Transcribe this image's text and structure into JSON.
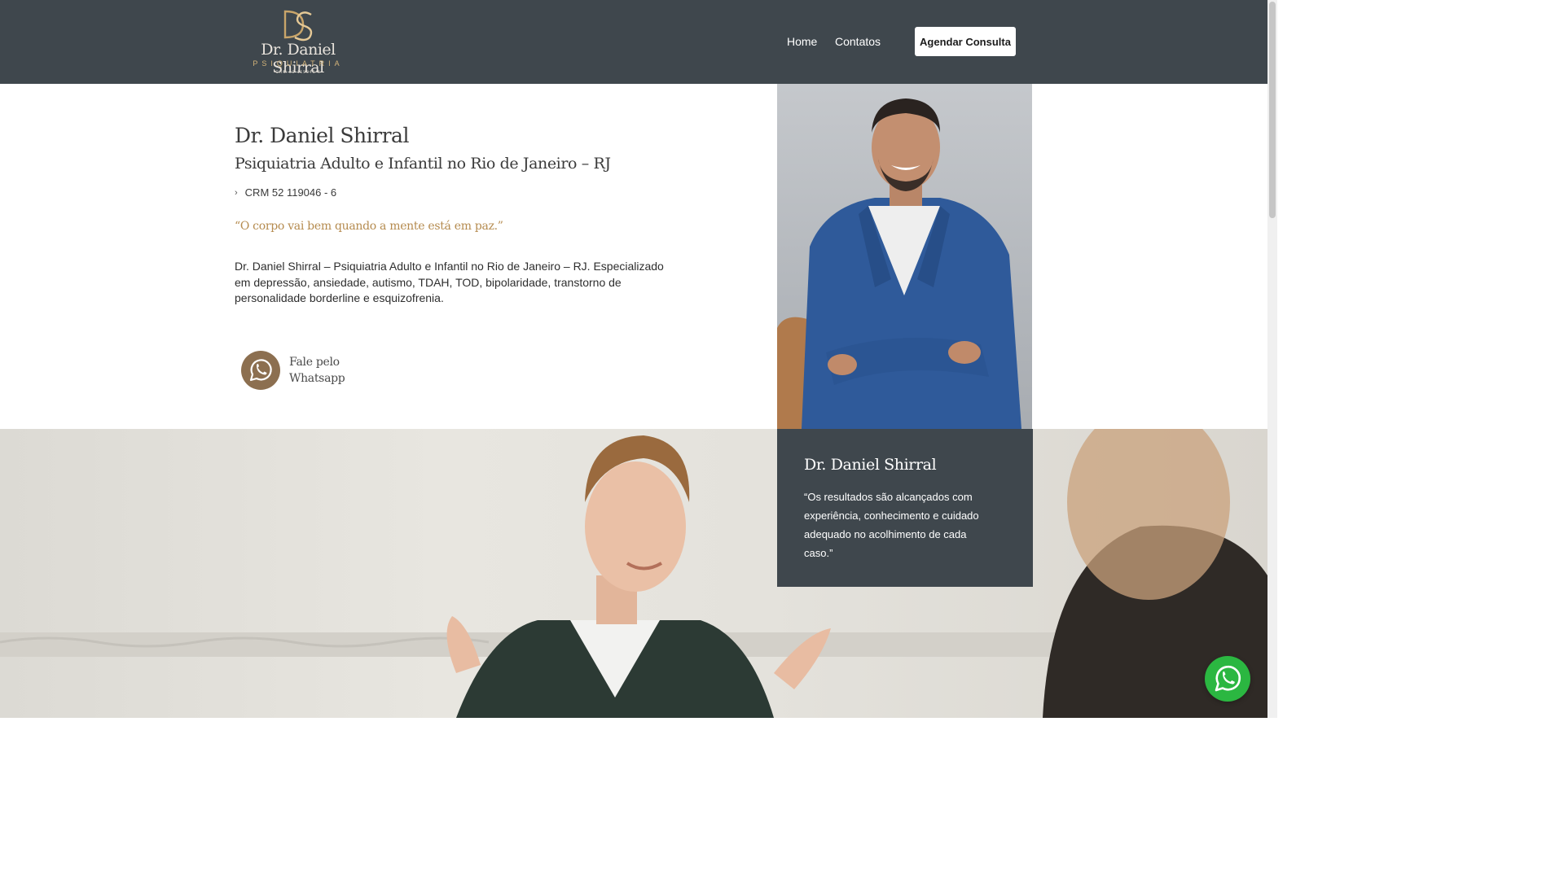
{
  "header": {
    "logo": {
      "monogram": "DS",
      "name": "Dr. Daniel Shirral",
      "specialty": "PSIQUIATRIA",
      "crm": "CRM 52 119046-6"
    },
    "nav": [
      {
        "label": "Home"
      },
      {
        "label": "Contatos"
      }
    ],
    "cta_label": "Agendar Consulta"
  },
  "intro": {
    "title": "Dr. Daniel Shirral",
    "subtitle": "Psiquiatria Adulto e Infantil no Rio de Janeiro – RJ",
    "crm": "CRM 52 119046 - 6",
    "quote": "“O corpo vai bem quando a mente está em paz.”",
    "description": "Dr. Daniel Shirral – Psiquiatria Adulto e Infantil no Rio de Janeiro – RJ. Especializado em depressão, ansiedade, autismo, TDAH, TOD, bipolaridade, transtorno de personalidade borderline e esquizofrenia.",
    "whatsapp_line1": "Fale pelo",
    "whatsapp_line2": "Whatsapp"
  },
  "card": {
    "title": "Dr. Daniel Shirral",
    "text": "“Os resultados são alcançados com experiência, conhecimento e cuidado adequado no acolhimento de cada caso.”"
  },
  "icons": {
    "whatsapp": "whatsapp-icon",
    "chevron": "chevron-right-icon",
    "float_whatsapp": "whatsapp-icon"
  },
  "colors": {
    "header_bg": "#3f474d",
    "gold": "#b58b4f",
    "whatsapp_green": "#2bb741",
    "whatsapp_brown": "#8c6f50"
  }
}
